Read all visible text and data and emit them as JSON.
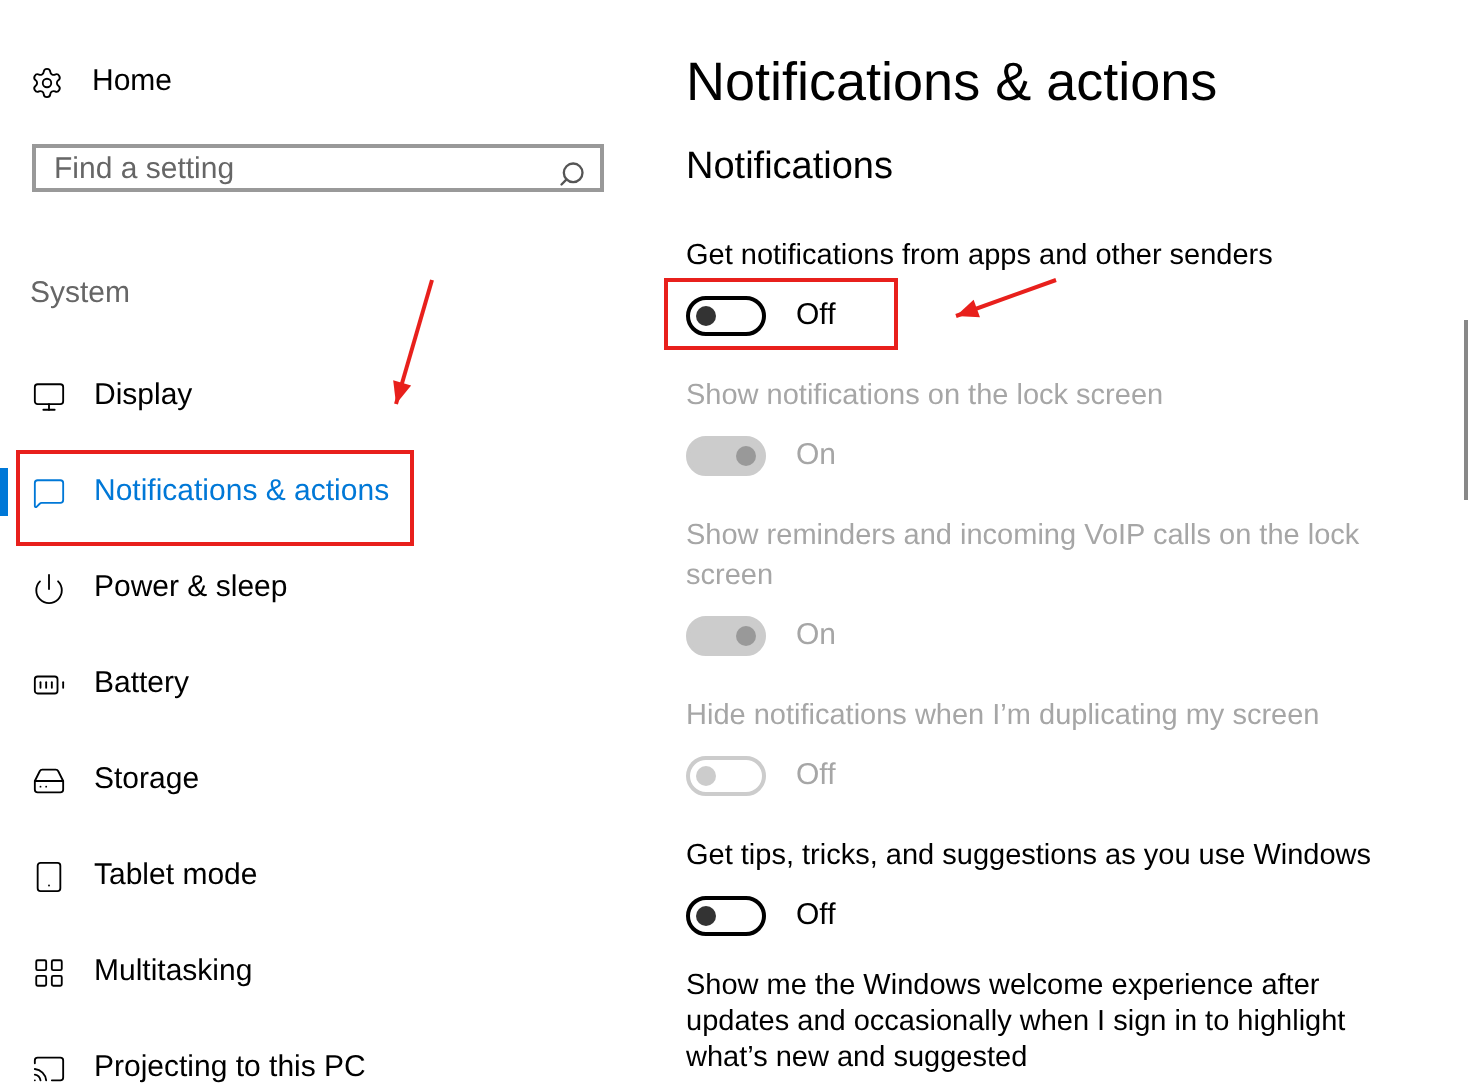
{
  "sidebar": {
    "home": "Home",
    "search": {
      "placeholder": "Find a setting"
    },
    "section": "System",
    "items": [
      {
        "label": "Display",
        "selected": false,
        "highlighted": false
      },
      {
        "label": "Notifications & actions",
        "selected": true,
        "highlighted": true
      },
      {
        "label": "Power & sleep",
        "selected": false,
        "highlighted": false
      },
      {
        "label": "Battery",
        "selected": false,
        "highlighted": false
      },
      {
        "label": "Storage",
        "selected": false,
        "highlighted": false
      },
      {
        "label": "Tablet mode",
        "selected": false,
        "highlighted": false
      },
      {
        "label": "Multitasking",
        "selected": false,
        "highlighted": false
      },
      {
        "label": "Projecting to this PC",
        "selected": false,
        "highlighted": false
      }
    ]
  },
  "content": {
    "title": "Notifications & actions",
    "heading": "Notifications",
    "settings": [
      {
        "kind": "toggle",
        "label": "Get notifications from apps and other senders",
        "on": false,
        "disabled": false,
        "state": "Off",
        "highlighted": true
      },
      {
        "kind": "toggle",
        "label": "Show notifications on the lock screen",
        "on": true,
        "disabled": true,
        "state": "On",
        "highlighted": false
      },
      {
        "kind": "toggle",
        "label": "Show reminders and incoming VoIP calls on the lock screen",
        "on": true,
        "disabled": true,
        "state": "On",
        "highlighted": false
      },
      {
        "kind": "toggle",
        "label": "Hide notifications when I’m duplicating my screen",
        "on": false,
        "disabled": true,
        "state": "Off",
        "highlighted": false
      },
      {
        "kind": "toggle",
        "label": "Get tips, tricks, and suggestions as you use Windows",
        "on": false,
        "disabled": false,
        "state": "Off",
        "highlighted": false
      },
      {
        "kind": "text",
        "label": "Show me the Windows welcome experience after updates and occasionally when I sign in to highlight what’s new and suggested"
      }
    ]
  }
}
